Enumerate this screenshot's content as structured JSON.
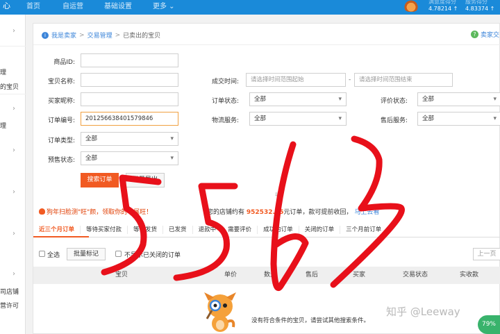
{
  "topbar": {
    "brand": "心",
    "nav": [
      "首页",
      "自运营",
      "基础设置",
      "更多 ⌄"
    ],
    "stat1_label": "满意度得分",
    "stat1_value": "4.78214 ↑",
    "stat2_label": "服务得分",
    "stat2_value": "4.83374 ↑"
  },
  "sidebar": {
    "lines": [
      "理",
      "的宝贝",
      "理",
      "司店铺",
      "营许可"
    ]
  },
  "breadcrumb": {
    "items": [
      "我是卖家",
      "交易管理",
      "已卖出的宝贝"
    ],
    "separator": ">"
  },
  "help_label": "卖家交",
  "form": {
    "item_id_label": "商品ID:",
    "item_name_label": "宝贝名称:",
    "buyer_label": "买家昵称:",
    "order_no_label": "订单编号:",
    "order_no_value": "201256638401579846",
    "order_type_label": "订单类型:",
    "order_type_value": "全部",
    "presale_label": "预售状态:",
    "presale_value": "全部",
    "deal_time_label": "成交时间:",
    "time_start_placeholder": "请选择时间范围起始",
    "time_dash": "-",
    "time_end_placeholder": "请选择时间范围结束",
    "order_status_label": "订单状态:",
    "order_status_value": "全部",
    "logistics_label": "物流服务:",
    "logistics_value": "全部",
    "review_label": "评价状态:",
    "review_value": "全部",
    "aftersale_label": "售后服务:",
    "aftersale_value": "全部",
    "search_button": "搜索订单",
    "export_button": "批量导出",
    "collapse_label": "收"
  },
  "promo": {
    "text": "狗年扫脸测\"旺\"颜，领取你的专属旺！"
  },
  "notice": {
    "prefix": "您的店铺约有",
    "amount": "952532.55",
    "suffix": "元订单，款可提前收回，",
    "link": "马上去看"
  },
  "tabs": [
    "近三个月订单",
    "等待买家付款",
    "等待发货",
    "已发货",
    "退款中",
    "需要评价",
    "成功的订单",
    "关闭的订单",
    "三个月前订单"
  ],
  "toolbar": {
    "select_all": "全选",
    "batch_mark": "批量标记",
    "hide_closed": "不显示已关闭的订单",
    "prev_page": "上一页"
  },
  "table_headers": [
    "宝贝",
    "单价",
    "数量",
    "售后",
    "买家",
    "交易状态",
    "实收款"
  ],
  "empty_message": "没有符合条件的宝贝，请尝试其他搜索条件。",
  "watermark": "知乎 @Leeway",
  "percent_badge": "79%",
  "handwriting": "5563",
  "colors": {
    "topbar": "#1a8ad9",
    "accent": "#f15a22",
    "link": "#3c85d9",
    "scribble": "#e8101a"
  }
}
